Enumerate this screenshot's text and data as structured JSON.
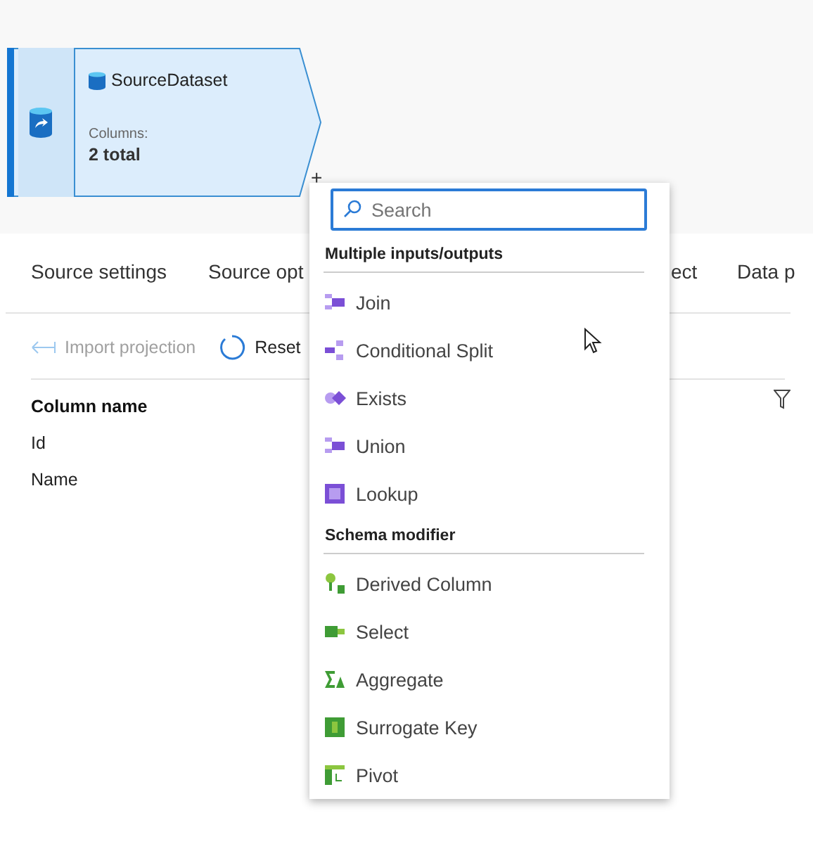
{
  "node": {
    "title": "SourceDataset",
    "columns_label": "Columns:",
    "columns_value": "2 total",
    "add_symbol": "+"
  },
  "tabs": [
    {
      "label": "Source settings"
    },
    {
      "label": "Source opt"
    },
    {
      "label": "ect"
    },
    {
      "label": "Data p"
    }
  ],
  "toolbar": [
    {
      "label": "Import projection",
      "disabled": true
    },
    {
      "label": "Reset",
      "disabled": false
    }
  ],
  "table": {
    "columns": [
      "Column name"
    ],
    "rows": [
      "Id",
      "Name"
    ]
  },
  "menu": {
    "search": {
      "placeholder": "Search"
    },
    "sections": [
      {
        "title": "Multiple inputs/outputs",
        "items": [
          "Join",
          "Conditional Split",
          "Exists",
          "Union",
          "Lookup"
        ]
      },
      {
        "title": "Schema modifier",
        "items": [
          "Derived Column",
          "Select",
          "Aggregate",
          "Surrogate Key",
          "Pivot"
        ]
      }
    ]
  }
}
